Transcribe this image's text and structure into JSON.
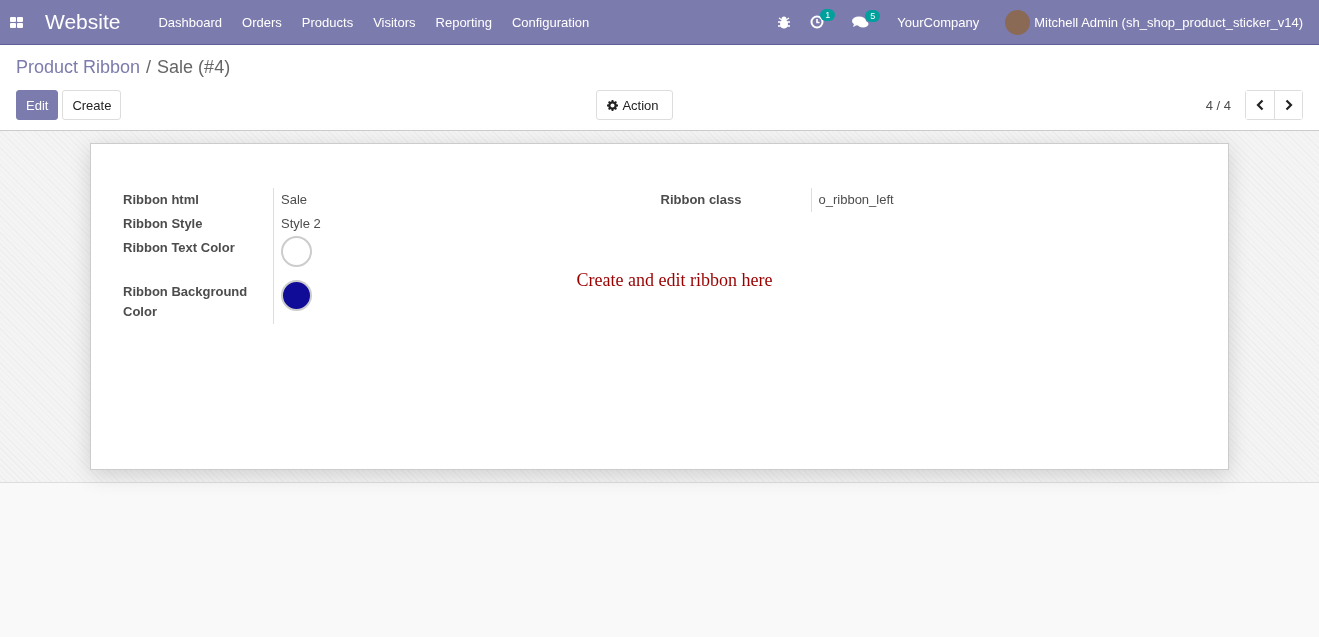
{
  "navbar": {
    "app_name": "Website",
    "menu": [
      {
        "label": "Dashboard"
      },
      {
        "label": "Orders"
      },
      {
        "label": "Products"
      },
      {
        "label": "Visitors"
      },
      {
        "label": "Reporting"
      },
      {
        "label": "Configuration"
      }
    ],
    "activity_count": "1",
    "message_count": "5",
    "company": "YourCompany",
    "user": "Mitchell Admin (sh_shop_product_sticker_v14)"
  },
  "breadcrumb": {
    "parent": "Product Ribbon",
    "separator": "/",
    "current": "Sale (#4)"
  },
  "buttons": {
    "edit": "Edit",
    "create": "Create",
    "action": "Action"
  },
  "pager": "4 / 4",
  "form": {
    "left_fields": [
      {
        "kind": "text",
        "label": "Ribbon html",
        "value": "Sale"
      },
      {
        "kind": "text",
        "label": "Ribbon Style",
        "value": "Style 2"
      },
      {
        "kind": "color",
        "label": "Ribbon Text Color",
        "color": "#ffffff"
      },
      {
        "kind": "color",
        "label": "Ribbon Background Color",
        "color": "#110c98"
      }
    ],
    "right_fields": [
      {
        "kind": "text",
        "label": "Ribbon class",
        "value": "o_ribbon_left"
      }
    ],
    "note": "Create and edit ribbon here"
  }
}
